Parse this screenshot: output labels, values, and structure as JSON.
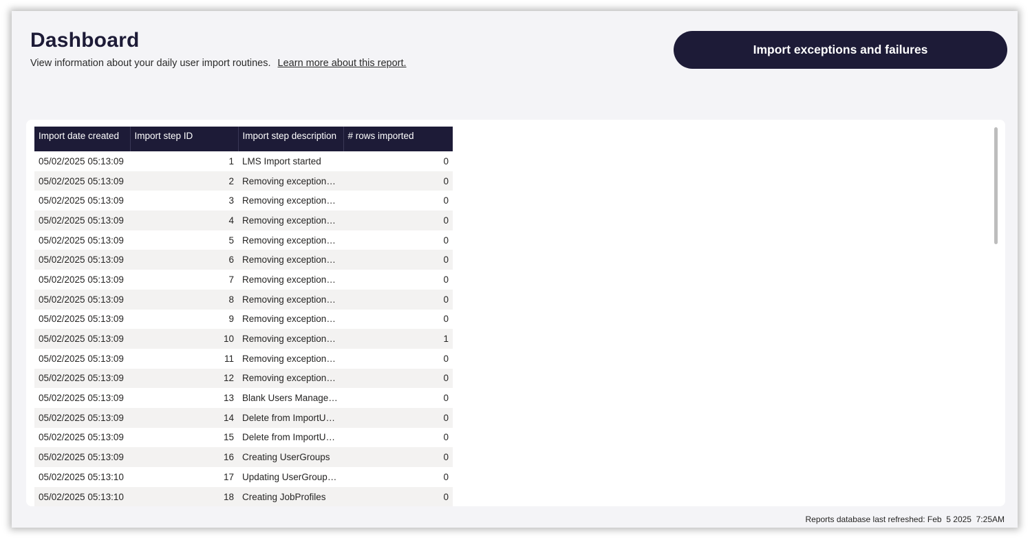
{
  "header": {
    "title": "Dashboard",
    "subtitle": "View information about your daily user import routines.",
    "learn_more_link": "Learn more about this report.",
    "import_button_label": "Import exceptions and failures"
  },
  "table": {
    "columns": [
      "Import date created",
      "Import step ID",
      "Import step description",
      "# rows imported"
    ],
    "rows": [
      [
        "05/02/2025 05:13:09",
        "1",
        " LMS Import started",
        "0"
      ],
      [
        "05/02/2025 05:13:09",
        "2",
        "Removing exception…",
        "0"
      ],
      [
        "05/02/2025 05:13:09",
        "3",
        "Removing exception…",
        "0"
      ],
      [
        "05/02/2025 05:13:09",
        "4",
        "Removing exception…",
        "0"
      ],
      [
        "05/02/2025 05:13:09",
        "5",
        "Removing exception…",
        "0"
      ],
      [
        "05/02/2025 05:13:09",
        "6",
        "Removing exception…",
        "0"
      ],
      [
        "05/02/2025 05:13:09",
        "7",
        "Removing exception…",
        "0"
      ],
      [
        "05/02/2025 05:13:09",
        "8",
        "Removing exception…",
        "0"
      ],
      [
        "05/02/2025 05:13:09",
        "9",
        "Removing exception…",
        "0"
      ],
      [
        "05/02/2025 05:13:09",
        "10",
        "Removing exception…",
        "1"
      ],
      [
        "05/02/2025 05:13:09",
        "11",
        "Removing exception…",
        "0"
      ],
      [
        "05/02/2025 05:13:09",
        "12",
        "Removing exception…",
        "0"
      ],
      [
        "05/02/2025 05:13:09",
        "13",
        "Blank Users Manage…",
        "0"
      ],
      [
        "05/02/2025 05:13:09",
        "14",
        "Delete from ImportU…",
        "0"
      ],
      [
        "05/02/2025 05:13:09",
        "15",
        "Delete from ImportU…",
        "0"
      ],
      [
        "05/02/2025 05:13:09",
        "16",
        "Creating UserGroups",
        "0"
      ],
      [
        "05/02/2025 05:13:10",
        "17",
        "Updating UserGroup…",
        "0"
      ],
      [
        "05/02/2025 05:13:10",
        "18",
        "Creating JobProfiles",
        "0"
      ]
    ]
  },
  "footer": {
    "refresh_text": "Reports database last refreshed: Feb  5 2025  7:25AM"
  },
  "colors": {
    "brand_dark": "#1d1b37",
    "page_bg": "#f4f4f7",
    "row_alt": "#f3f2f1"
  }
}
